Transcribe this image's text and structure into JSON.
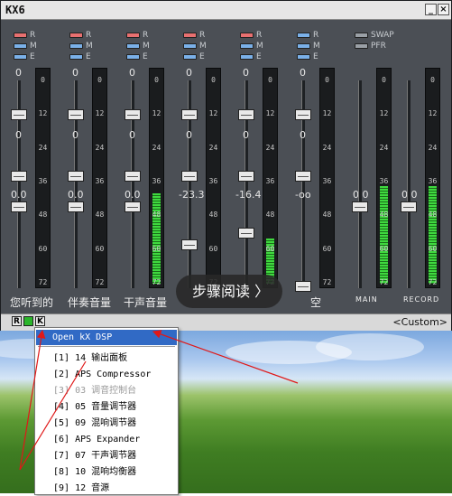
{
  "window": {
    "title": "KX6",
    "minimize_glyph": "_",
    "close_glyph": "×"
  },
  "channel_buttons": {
    "r": "R",
    "m": "M",
    "e": "E"
  },
  "swap_buttons": {
    "swap": "SWAP",
    "pfr": "PFR"
  },
  "channels": [
    {
      "id": "ch1",
      "label": "您听到的",
      "top_value": "0",
      "mid_value": "0",
      "bottom_value": "0.0",
      "meter_level": 0.0
    },
    {
      "id": "ch2",
      "label": "伴奏音量",
      "top_value": "0",
      "mid_value": "0",
      "bottom_value": "0.0",
      "meter_level": 0.0
    },
    {
      "id": "ch3",
      "label": "干声音量",
      "top_value": "0",
      "mid_value": "0",
      "bottom_value": "0.0",
      "meter_level": 0.55
    },
    {
      "id": "ch4",
      "label": "",
      "top_value": "0",
      "mid_value": "0",
      "bottom_value": "-23.3",
      "meter_level": 0.0
    },
    {
      "id": "ch5",
      "label": "",
      "top_value": "0",
      "mid_value": "0",
      "bottom_value": "-16.4",
      "meter_level": 0.28
    },
    {
      "id": "ch6",
      "label": "空",
      "top_value": "0",
      "mid_value": "0",
      "bottom_value": "-oo",
      "meter_level": 0.0
    }
  ],
  "main": {
    "label": "MAIN",
    "value": "0.0",
    "meter_level": 0.6
  },
  "record": {
    "label": "RECORD",
    "value": "0.0",
    "meter_level": 0.6
  },
  "meter_ticks": [
    "0",
    "12",
    "24",
    "36",
    "48",
    "60",
    "72"
  ],
  "status_bar": {
    "r": "R",
    "k": "K",
    "preset": "<Custom>"
  },
  "overlay": {
    "step_reading": "步骤阅读 〉"
  },
  "context_menu": {
    "items": [
      {
        "label": "Open kX DSP",
        "highlighted": true,
        "disabled": false
      },
      {
        "label": "[1] 14 输出面板",
        "highlighted": false,
        "disabled": false
      },
      {
        "label": "[2] APS Compressor",
        "highlighted": false,
        "disabled": false
      },
      {
        "label": "[3] 03 调音控制台",
        "highlighted": false,
        "disabled": true
      },
      {
        "label": "[4] 05 音量调节器",
        "highlighted": false,
        "disabled": false
      },
      {
        "label": "[5] 09 混响调节器",
        "highlighted": false,
        "disabled": false
      },
      {
        "label": "[6] APS Expander",
        "highlighted": false,
        "disabled": false
      },
      {
        "label": "[7] 07 干声调节器",
        "highlighted": false,
        "disabled": false
      },
      {
        "label": "[8] 10 混响均衡器",
        "highlighted": false,
        "disabled": false
      },
      {
        "label": "[9] 12 音源",
        "highlighted": false,
        "disabled": false
      }
    ]
  },
  "colors": {
    "window_bg": "#4b4f55",
    "menu_highlight": "#316ac5",
    "meter_green": "#3fd93f",
    "arrow_red": "#e01818"
  }
}
